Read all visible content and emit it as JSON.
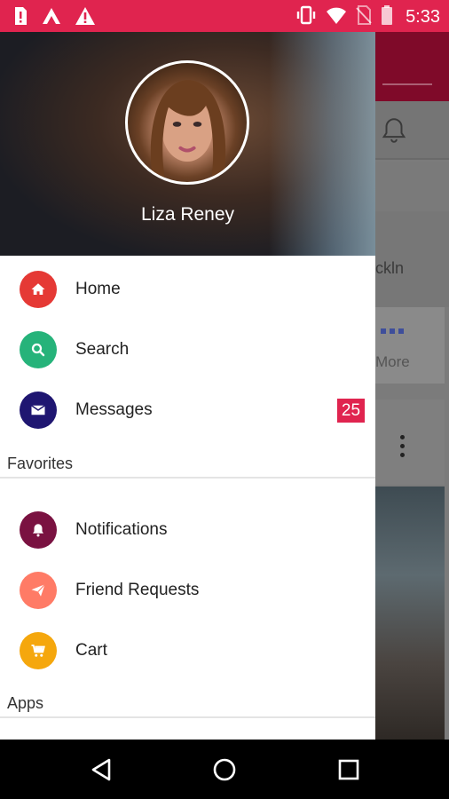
{
  "status_bar": {
    "time": "5:33",
    "left_icons": [
      "sim-alert-icon",
      "app-icon",
      "warning-icon"
    ],
    "right_icons": [
      "vibrate-icon",
      "wifi-icon",
      "no-sim-icon",
      "battery-icon"
    ],
    "color": "#e0244f"
  },
  "drawer": {
    "profile": {
      "name": "Liza Reney"
    },
    "items": [
      {
        "label": "Home",
        "icon": "home-icon",
        "color": "#e53935"
      },
      {
        "label": "Search",
        "icon": "search-icon",
        "color": "#26b37a"
      },
      {
        "label": "Messages",
        "icon": "mail-icon",
        "color": "#1f1671",
        "badge": "25"
      }
    ],
    "sections": [
      {
        "title": "Favorites",
        "items": [
          {
            "label": "Notifications",
            "icon": "bell-icon",
            "color": "#7a1241"
          },
          {
            "label": "Friend Requests",
            "icon": "send-icon",
            "color": "#ff7b66"
          },
          {
            "label": "Cart",
            "icon": "cart-icon",
            "color": "#f5a70d"
          }
        ]
      },
      {
        "title": "Apps",
        "items": []
      }
    ]
  },
  "background": {
    "partial_text_1": "ckln",
    "partial_text_2": "More"
  },
  "nav_bar": {
    "buttons": [
      "back-icon",
      "home-circle-icon",
      "recents-icon"
    ]
  }
}
